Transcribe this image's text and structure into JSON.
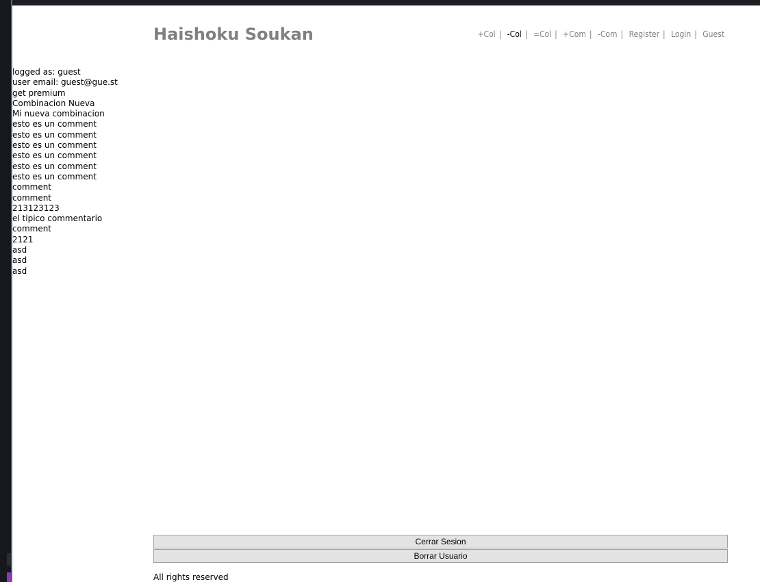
{
  "header": {
    "title": "Haishoku Soukan"
  },
  "nav": {
    "separator": "|",
    "items": [
      {
        "label": "+Col"
      },
      {
        "label": "-Col"
      },
      {
        "label": "=Col"
      },
      {
        "label": "+Com"
      },
      {
        "label": "-Com"
      },
      {
        "label": "Register"
      },
      {
        "label": "Login"
      },
      {
        "label": "Guest"
      }
    ],
    "active": "-Col"
  },
  "sidebar": {
    "logged_as": "logged as: guest",
    "user_email": "user email: guest@gue.st",
    "get_premium": "get premium",
    "new_combination": "Combinacion Nueva",
    "my_combination": "Mi nueva combinacion",
    "comments": [
      "esto es un comment",
      "esto es un comment",
      "esto es un comment",
      "esto es un comment",
      "esto es un comment",
      "esto es un comment",
      "comment",
      "comment",
      "213123123",
      "el tipico commentario",
      "comment",
      "2121",
      "asd",
      "asd",
      "asd"
    ]
  },
  "actions": {
    "logout_label": "Cerrar Sesion",
    "delete_user_label": "Borrar Usuario"
  },
  "footer": {
    "text": "All rights reserved"
  },
  "colors": {
    "title": "#808080",
    "nav_link": "#808080",
    "nav_active": "#000000",
    "button_bg": "#e3e3e3",
    "button_border": "#a0a0a0",
    "frame_dark": "#16181d",
    "frame_accent": "#3b6ea5"
  }
}
